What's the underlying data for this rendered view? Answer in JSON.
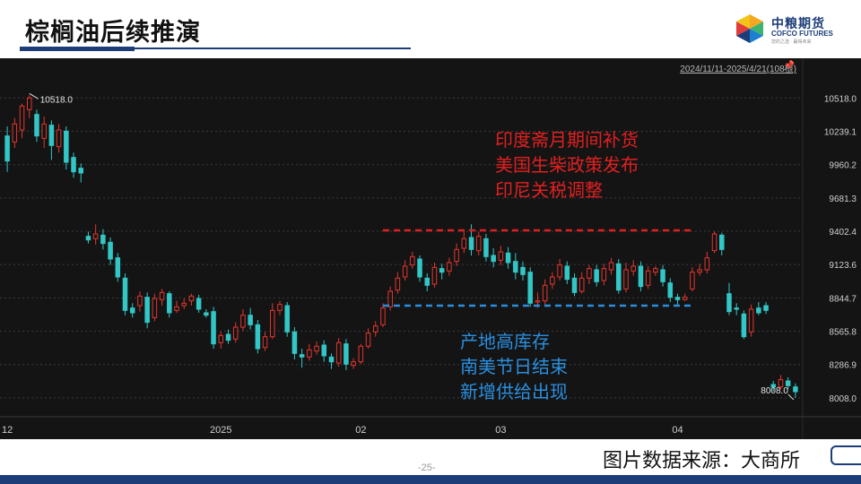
{
  "header": {
    "title": "棕榈油后续推演",
    "logo_cn": "中粮期货",
    "logo_en": "COFCO FUTURES",
    "logo_sub": "您的之选 · 赢得未来"
  },
  "footer": {
    "source": "图片数据来源：大商所",
    "page_number": "-25-"
  },
  "colors": {
    "up": "#e3362e",
    "down": "#33c6c6",
    "background": "#141414",
    "grid": "#3a3a3a",
    "resistance": "#e02020",
    "support": "#2a8fe0",
    "brand": "#1c3d78"
  },
  "chart_data": {
    "type": "candlestick",
    "range_label": "2024/11/11-2025/4/21(108根)",
    "y_ticks": [
      "10518.0",
      "10239.1",
      "9960.2",
      "9681.3",
      "9402.4",
      "9123.6",
      "8844.7",
      "8565.8",
      "8286.9",
      "8008.0"
    ],
    "ylim": [
      7850,
      10700
    ],
    "x_ticks": [
      {
        "label": "12",
        "index": 0
      },
      {
        "label": "2025",
        "index": 29
      },
      {
        "label": "02",
        "index": 48
      },
      {
        "label": "03",
        "index": 67
      },
      {
        "label": "04",
        "index": 91
      }
    ],
    "max_label": "10518.0",
    "min_label": "8008.0",
    "resistance": {
      "value": 9410,
      "from": 51,
      "to": 93
    },
    "support": {
      "value": 8780,
      "from": 51,
      "to": 93
    },
    "annotations_up": [
      "印度斋月期间补货",
      "美国生柴政策发布",
      "印尼关税调整"
    ],
    "annotations_down": [
      "产地高库存",
      "南美节日结束",
      "新增供给出现"
    ],
    "candles": [
      [
        10200,
        9990,
        10280,
        9900
      ],
      [
        10150,
        10300,
        10350,
        10100
      ],
      [
        10250,
        10450,
        10470,
        10180
      ],
      [
        10420,
        10518,
        10540,
        10350
      ],
      [
        10380,
        10200,
        10420,
        10150
      ],
      [
        10180,
        10300,
        10360,
        10100
      ],
      [
        10290,
        10120,
        10330,
        10000
      ],
      [
        10110,
        10250,
        10300,
        10060
      ],
      [
        10240,
        9980,
        10280,
        9920
      ],
      [
        10020,
        9900,
        10060,
        9850
      ],
      [
        9930,
        9890,
        9970,
        9810
      ],
      [
        9360,
        9330,
        9400,
        9300
      ],
      [
        9340,
        9380,
        9460,
        9290
      ],
      [
        9370,
        9300,
        9420,
        9250
      ],
      [
        9310,
        9170,
        9350,
        9120
      ],
      [
        9180,
        9020,
        9220,
        8980
      ],
      [
        9010,
        8740,
        9050,
        8700
      ],
      [
        8760,
        8720,
        8800,
        8680
      ],
      [
        8780,
        8860,
        8900,
        8730
      ],
      [
        8850,
        8640,
        8890,
        8590
      ],
      [
        8680,
        8840,
        8880,
        8650
      ],
      [
        8830,
        8890,
        8920,
        8780
      ],
      [
        8880,
        8720,
        8900,
        8680
      ],
      [
        8740,
        8770,
        8820,
        8720
      ],
      [
        8780,
        8800,
        8840,
        8750
      ],
      [
        8820,
        8860,
        8880,
        8780
      ],
      [
        8840,
        8750,
        8870,
        8720
      ],
      [
        8720,
        8700,
        8750,
        8680
      ],
      [
        8730,
        8460,
        8770,
        8420
      ],
      [
        8470,
        8530,
        8560,
        8420
      ],
      [
        8540,
        8490,
        8580,
        8460
      ],
      [
        8500,
        8600,
        8640,
        8470
      ],
      [
        8600,
        8700,
        8750,
        8570
      ],
      [
        8700,
        8620,
        8760,
        8580
      ],
      [
        8620,
        8420,
        8660,
        8380
      ],
      [
        8430,
        8520,
        8560,
        8400
      ],
      [
        8520,
        8740,
        8800,
        8500
      ],
      [
        8740,
        8790,
        8820,
        8700
      ],
      [
        8780,
        8560,
        8810,
        8520
      ],
      [
        8560,
        8380,
        8600,
        8330
      ],
      [
        8370,
        8350,
        8420,
        8260
      ],
      [
        8350,
        8410,
        8460,
        8320
      ],
      [
        8400,
        8440,
        8480,
        8370
      ],
      [
        8450,
        8360,
        8490,
        8310
      ],
      [
        8350,
        8310,
        8380,
        8250
      ],
      [
        8300,
        8470,
        8510,
        8270
      ],
      [
        8460,
        8290,
        8500,
        8240
      ],
      [
        8280,
        8310,
        8340,
        8250
      ],
      [
        8310,
        8440,
        8460,
        8290
      ],
      [
        8440,
        8550,
        8590,
        8420
      ],
      [
        8560,
        8610,
        8650,
        8520
      ],
      [
        8620,
        8760,
        8800,
        8600
      ],
      [
        8770,
        8900,
        8940,
        8740
      ],
      [
        8910,
        9010,
        9060,
        8880
      ],
      [
        9020,
        9110,
        9160,
        8990
      ],
      [
        9120,
        9190,
        9230,
        9090
      ],
      [
        9170,
        9020,
        9200,
        8980
      ],
      [
        9010,
        8950,
        9050,
        8900
      ],
      [
        8960,
        9100,
        9140,
        8930
      ],
      [
        9090,
        9060,
        9130,
        9000
      ],
      [
        9070,
        9140,
        9180,
        9030
      ],
      [
        9150,
        9250,
        9300,
        9110
      ],
      [
        9260,
        9340,
        9420,
        9220
      ],
      [
        9350,
        9250,
        9460,
        9200
      ],
      [
        9240,
        9360,
        9400,
        9200
      ],
      [
        9340,
        9190,
        9380,
        9150
      ],
      [
        9200,
        9150,
        9260,
        9100
      ],
      [
        9160,
        9230,
        9280,
        9120
      ],
      [
        9220,
        9140,
        9270,
        9090
      ],
      [
        9150,
        9060,
        9220,
        9000
      ],
      [
        9100,
        9040,
        9150,
        8990
      ],
      [
        9060,
        8800,
        9100,
        8770
      ],
      [
        8810,
        8820,
        8890,
        8760
      ],
      [
        8820,
        8950,
        9000,
        8780
      ],
      [
        8960,
        9020,
        9060,
        8920
      ],
      [
        9020,
        9120,
        9170,
        8990
      ],
      [
        9110,
        9000,
        9150,
        8960
      ],
      [
        9010,
        8890,
        9050,
        8860
      ],
      [
        8900,
        9010,
        9060,
        8880
      ],
      [
        9010,
        9090,
        9120,
        8960
      ],
      [
        9080,
        8980,
        9120,
        8940
      ],
      [
        8990,
        9090,
        9130,
        8950
      ],
      [
        9080,
        9140,
        9180,
        9040
      ],
      [
        9130,
        8910,
        9170,
        8880
      ],
      [
        8920,
        9080,
        9140,
        8890
      ],
      [
        9070,
        9110,
        9160,
        9030
      ],
      [
        9110,
        8940,
        9150,
        8900
      ],
      [
        8950,
        9070,
        9110,
        8920
      ],
      [
        9060,
        9090,
        9110,
        9030
      ],
      [
        9080,
        8980,
        9120,
        8940
      ],
      [
        8970,
        8850,
        9010,
        8810
      ],
      [
        8850,
        8830,
        8880,
        8790
      ],
      [
        8830,
        8850,
        8880,
        8820
      ],
      [
        8920,
        9060,
        9100,
        8900
      ],
      [
        9060,
        9080,
        9130,
        9030
      ],
      [
        9080,
        9180,
        9230,
        9050
      ],
      [
        9240,
        9380,
        9400,
        9220
      ],
      [
        9370,
        9250,
        9390,
        9200
      ],
      [
        8880,
        8730,
        8970,
        8700
      ],
      [
        8760,
        8750,
        8800,
        8700
      ],
      [
        8710,
        8520,
        8740,
        8500
      ],
      [
        8560,
        8750,
        8790,
        8520
      ],
      [
        8760,
        8720,
        8810,
        8700
      ],
      [
        8780,
        8740,
        8810,
        8710
      ],
      [
        8120,
        8100,
        8150,
        8060
      ],
      [
        8100,
        8160,
        8200,
        8080
      ],
      [
        8150,
        8110,
        8180,
        8080
      ],
      [
        8100,
        8060,
        8130,
        8008
      ]
    ]
  }
}
